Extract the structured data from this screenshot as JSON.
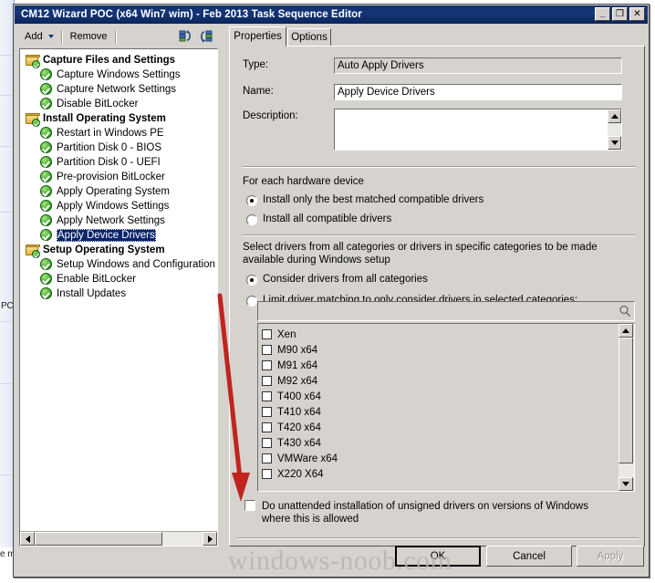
{
  "window": {
    "title": "CM12 Wizard POC (x64 Win7 wim) - Feb 2013 Task Sequence Editor",
    "minimize_label": "_",
    "maximize_label": "❐",
    "close_label": "✕"
  },
  "toolbar": {
    "add_label": "Add",
    "remove_label": "Remove",
    "icon_left_name": "move-up-icon",
    "icon_right_name": "move-down-icon"
  },
  "tree": {
    "nodes": [
      {
        "label": "Capture Files and Settings",
        "type": "group",
        "selected": false
      },
      {
        "label": "Capture Windows Settings",
        "type": "step",
        "selected": false
      },
      {
        "label": "Capture Network Settings",
        "type": "step",
        "selected": false
      },
      {
        "label": "Disable BitLocker",
        "type": "step",
        "selected": false
      },
      {
        "label": "Install Operating System",
        "type": "group",
        "selected": false
      },
      {
        "label": "Restart in Windows PE",
        "type": "step",
        "selected": false
      },
      {
        "label": "Partition Disk 0 - BIOS",
        "type": "step",
        "selected": false
      },
      {
        "label": "Partition Disk 0 - UEFI",
        "type": "step",
        "selected": false
      },
      {
        "label": "Pre-provision BitLocker",
        "type": "step",
        "selected": false
      },
      {
        "label": "Apply Operating System",
        "type": "step",
        "selected": false
      },
      {
        "label": "Apply Windows Settings",
        "type": "step",
        "selected": false
      },
      {
        "label": "Apply Network Settings",
        "type": "step",
        "selected": false
      },
      {
        "label": "Apply Device Drivers",
        "type": "step",
        "selected": true
      },
      {
        "label": "Setup Operating System",
        "type": "group",
        "selected": false
      },
      {
        "label": "Setup Windows and Configuration",
        "type": "step",
        "selected": false
      },
      {
        "label": "Enable BitLocker",
        "type": "step",
        "selected": false
      },
      {
        "label": "Install Updates",
        "type": "step",
        "selected": false
      }
    ]
  },
  "tabs": [
    {
      "label": "Properties",
      "active": true
    },
    {
      "label": "Options",
      "active": false
    }
  ],
  "properties": {
    "type_label": "Type:",
    "type_value": "Auto Apply Drivers",
    "name_label": "Name:",
    "name_value": "Apply Device Drivers",
    "description_label": "Description:",
    "description_value": "",
    "hardware_group_label": "For each hardware device",
    "radio_best_match": "Install only the best matched compatible drivers",
    "radio_all_compatible": "Install all compatible drivers",
    "hardware_selected": "best",
    "categories_intro": "Select drivers from all categories or drivers in specific categories to be made available during Windows setup",
    "radio_all_categories": "Consider drivers from all categories",
    "radio_limit_categories": "Limit driver matching to only consider drivers in selected categories:",
    "categories_selected": "all",
    "search_placeholder": "",
    "search_value": "",
    "search_icon_name": "search-icon",
    "driver_categories": [
      {
        "label": "Xen",
        "checked": false
      },
      {
        "label": "M90 x64",
        "checked": false
      },
      {
        "label": "M91 x64",
        "checked": false
      },
      {
        "label": "M92 x64",
        "checked": false
      },
      {
        "label": "T400 x64",
        "checked": false
      },
      {
        "label": "T410 x64",
        "checked": false
      },
      {
        "label": "T420 x64",
        "checked": false
      },
      {
        "label": "T430 x64",
        "checked": false
      },
      {
        "label": "VMWare x64",
        "checked": false
      },
      {
        "label": "X220 X64",
        "checked": false
      }
    ],
    "unattended_label": "Do unattended installation of unsigned drivers on versions of Windows where this is allowed",
    "unattended_checked": false
  },
  "buttons": {
    "ok": "OK",
    "cancel": "Cancel",
    "apply": "Apply",
    "apply_disabled": true
  },
  "annotation": {
    "arrow_name": "red-arrow-annotation",
    "arrow_color": "#c0241f"
  },
  "background": {
    "text_pc": "PC",
    "text_em": "e m"
  },
  "watermark": {
    "text": "windows-noob.com"
  }
}
